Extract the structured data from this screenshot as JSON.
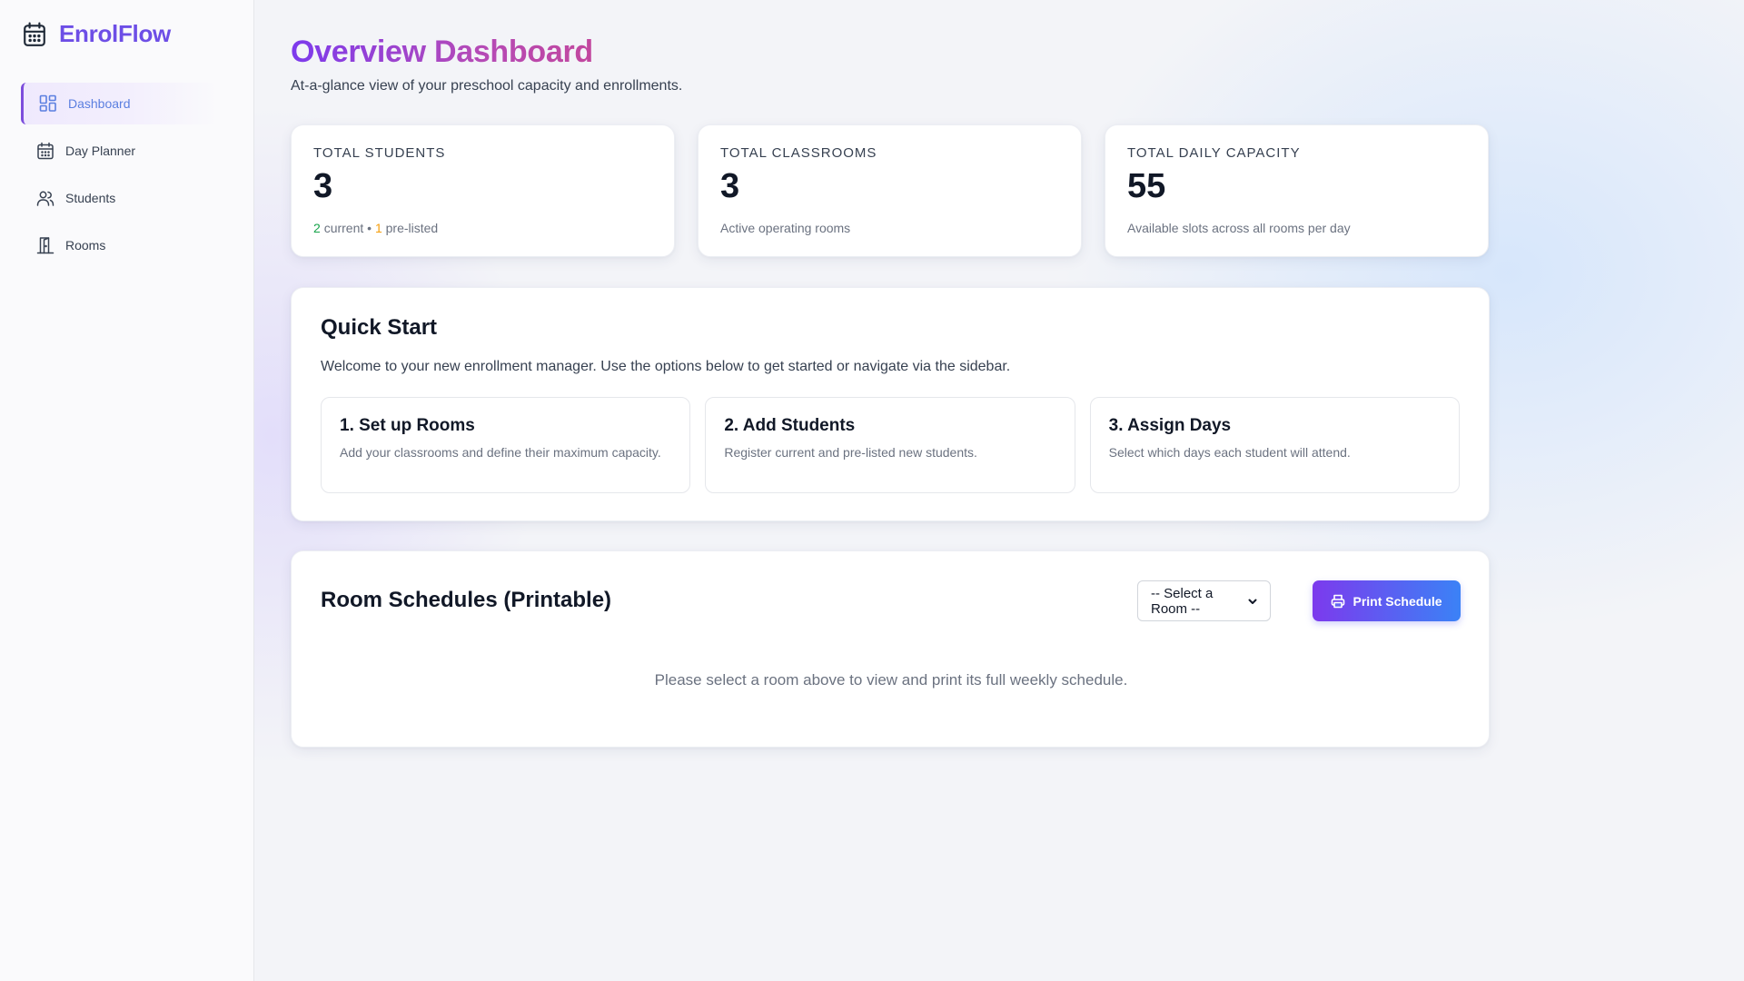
{
  "sidebar": {
    "brand": {
      "name": "EnrolFlow",
      "icon": "calendar-icon"
    },
    "items": [
      {
        "label": "Dashboard",
        "icon": "dashboard-icon",
        "active": true
      },
      {
        "label": "Day Planner",
        "icon": "calendar-icon",
        "active": false
      },
      {
        "label": "Students",
        "icon": "users-icon",
        "active": false
      },
      {
        "label": "Rooms",
        "icon": "door-icon",
        "active": false
      }
    ]
  },
  "header": {
    "title": "Overview Dashboard",
    "subtitle": "At-a-glance view of your preschool capacity and enrollments."
  },
  "stats": [
    {
      "label": "Total Students",
      "value": "3",
      "current_count": "2",
      "current_text": "current",
      "separator": "•",
      "prelisted_count": "1",
      "prelisted_text": "pre-listed"
    },
    {
      "label": "Total Classrooms",
      "value": "3",
      "sub": "Active operating rooms"
    },
    {
      "label": "Total Daily Capacity",
      "value": "55",
      "sub": "Available slots across all rooms per day"
    }
  ],
  "quick_start": {
    "title": "Quick Start",
    "intro": "Welcome to your new enrollment manager. Use the options below to get started or navigate via the sidebar.",
    "steps": [
      {
        "title": "1. Set up Rooms",
        "desc": "Add your classrooms and define their maximum capacity."
      },
      {
        "title": "2. Add Students",
        "desc": "Register current and pre-listed new students."
      },
      {
        "title": "3. Assign Days",
        "desc": "Select which days each student will attend."
      }
    ]
  },
  "schedules": {
    "title": "Room Schedules (Printable)",
    "select_value": "-- Select a Room --",
    "print_label": "Print Schedule",
    "empty_message": "Please select a room above to view and print its full weekly schedule."
  },
  "colors": {
    "brand": "#6d4ee6",
    "accent_purple": "#7c3aed",
    "accent_blue": "#3b82f6",
    "current": "#16a34a",
    "prelisted": "#f59e0b"
  }
}
